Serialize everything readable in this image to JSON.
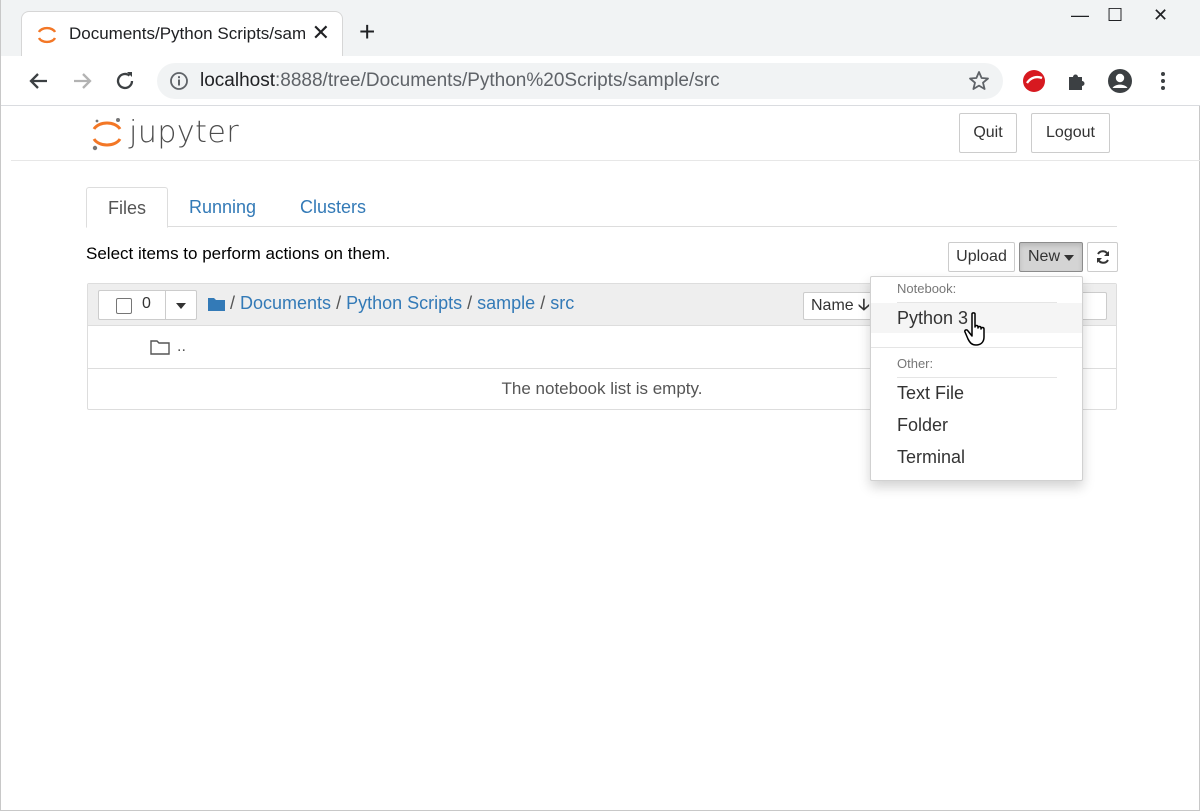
{
  "browser": {
    "tab_title": "Documents/Python Scripts/sample/src",
    "close_glyph": "✕",
    "newtab_glyph": "+",
    "window_controls": {
      "minimize": "—",
      "maximize": "☐",
      "close": "✕"
    },
    "url_host": "localhost",
    "url_rest": ":8888/tree/Documents/Python%20Scripts/sample/src"
  },
  "header": {
    "logo_text": "jupyter",
    "quit_label": "Quit",
    "logout_label": "Logout"
  },
  "tabs": [
    {
      "label": "Files",
      "active": true
    },
    {
      "label": "Running",
      "active": false
    },
    {
      "label": "Clusters",
      "active": false
    }
  ],
  "toolbar": {
    "hint": "Select items to perform actions on them.",
    "upload_label": "Upload",
    "new_label": "New"
  },
  "list": {
    "selected_count": "0",
    "breadcrumbs": [
      "Documents",
      "Python Scripts",
      "sample",
      "src"
    ],
    "sort_label": "Name",
    "sort_arrow": "🡣",
    "up_label": "..",
    "empty_message": "The notebook list is empty."
  },
  "new_menu": {
    "notebook_header": "Notebook:",
    "notebook_items": [
      "Python 3"
    ],
    "other_header": "Other:",
    "other_items": [
      "Text File",
      "Folder",
      "Terminal"
    ]
  },
  "colors": {
    "link": "#337ab7",
    "jupyter_orange": "#f37726",
    "chrome_bg": "#f1f3f4"
  }
}
